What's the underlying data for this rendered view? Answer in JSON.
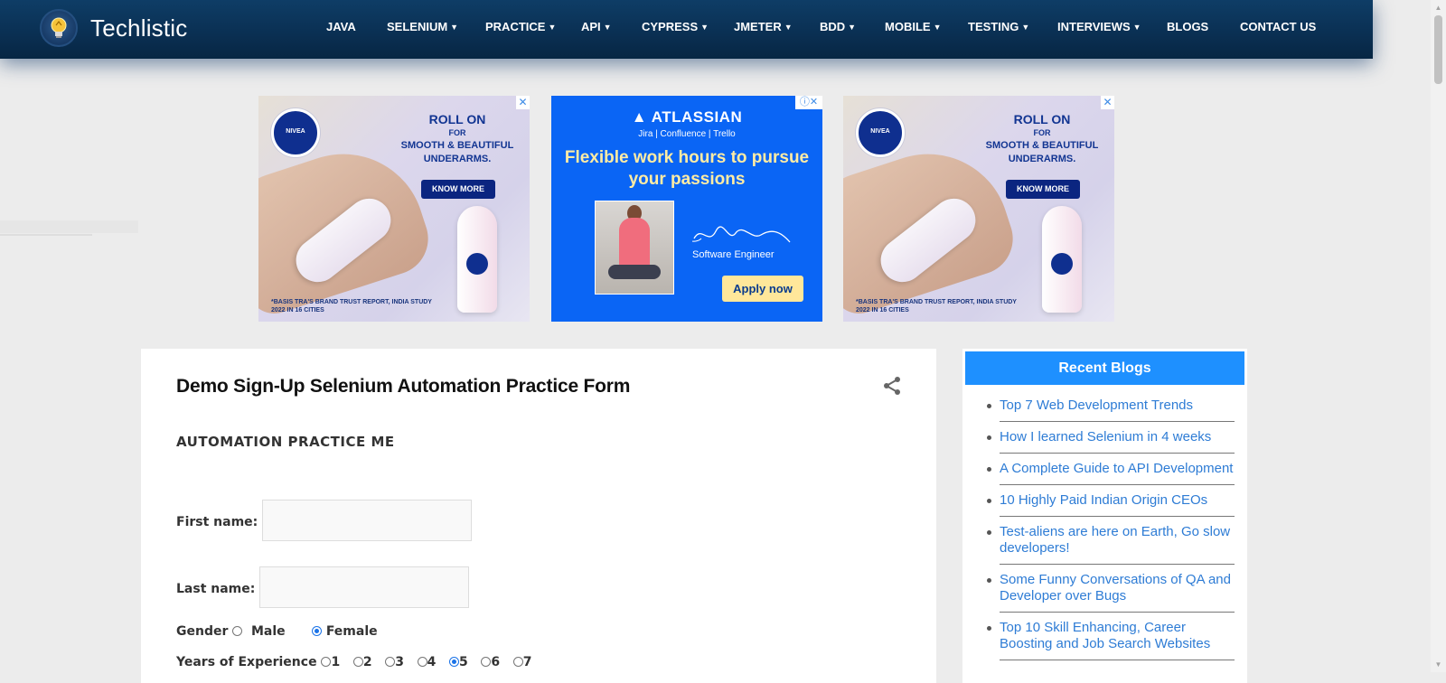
{
  "header": {
    "site_name": "Techlistic",
    "nav": [
      {
        "label": "JAVA",
        "caret": false
      },
      {
        "label": "SELENIUM",
        "caret": true
      },
      {
        "label": "PRACTICE",
        "caret": true
      },
      {
        "label": "API",
        "caret": true
      },
      {
        "label": "CYPRESS",
        "caret": true
      },
      {
        "label": "JMETER",
        "caret": true
      },
      {
        "label": "BDD",
        "caret": true
      },
      {
        "label": "MOBILE",
        "caret": true
      },
      {
        "label": "TESTING",
        "caret": true
      },
      {
        "label": "INTERVIEWS",
        "caret": true
      },
      {
        "label": "BLOGS",
        "caret": false
      },
      {
        "label": "CONTACT US",
        "caret": false
      }
    ]
  },
  "ads": {
    "nivea": {
      "brand": "NIVEA",
      "headline1": "ROLL ON",
      "headline2": "FOR",
      "headline3": "SMOOTH & BEAUTIFUL UNDERARMS.",
      "cta": "KNOW MORE",
      "footer": "*BASIS TRA'S BRAND TRUST REPORT, INDIA STUDY 2022 IN 16 CITIES"
    },
    "atlassian": {
      "brand": "ATLASSIAN",
      "products": "Jira | Confluence | Trello",
      "headline": "Flexible work hours to pursue your passions",
      "role": "Software Engineer",
      "cta": "Apply now"
    }
  },
  "article": {
    "title": "Demo Sign-Up Selenium Automation Practice Form",
    "section": "AUTOMATION PRACTICE ME",
    "first_name_label": "First name:",
    "first_name_value": "",
    "last_name_label": "Last name:",
    "last_name_value": "",
    "gender_label": "Gender",
    "gender_options": [
      "Male",
      "Female"
    ],
    "gender_selected": "Female",
    "experience_label": "Years of Experience",
    "experience_options": [
      "1",
      "2",
      "3",
      "4",
      "5",
      "6",
      "7"
    ],
    "experience_selected": "5"
  },
  "sidebar": {
    "title": "Recent Blogs",
    "items": [
      "Top 7 Web Development Trends",
      "How I learned Selenium in 4 weeks",
      "A Complete Guide to API Development",
      "10 Highly Paid Indian Origin CEOs",
      "Test-aliens are here on Earth, Go slow developers!",
      "Some Funny Conversations of QA and Developer over Bugs",
      "Top 10 Skill Enhancing, Career Boosting and Job Search Websites"
    ]
  },
  "colors": {
    "header_bg": "#0a2f52",
    "sidebar_header": "#1e90ff",
    "link": "#2e7cd5",
    "atlassian_bg": "#0a65f5"
  }
}
